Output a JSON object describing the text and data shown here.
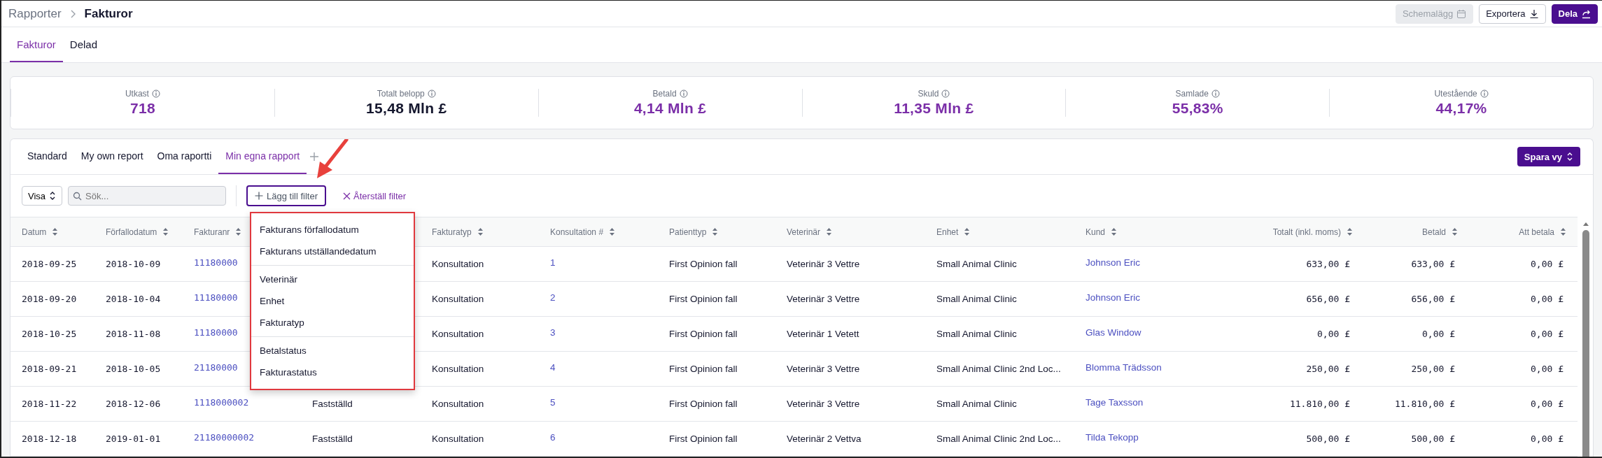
{
  "breadcrumb": [
    {
      "label": "Rapporter",
      "current": false
    },
    {
      "label": "Fakturor",
      "current": true
    }
  ],
  "actions": [
    {
      "label": "Schemalägg",
      "kind": "secondary",
      "disabled": true
    },
    {
      "label": "Exportera",
      "kind": "secondary",
      "disabled": false
    },
    {
      "label": "Dela",
      "kind": "primary",
      "disabled": false
    }
  ],
  "page_tabs": [
    {
      "label": "Fakturor",
      "selected": true
    },
    {
      "label": "Delad",
      "selected": false
    }
  ],
  "kpis": [
    {
      "label": "Utkast",
      "value": "718",
      "color": "#7b2fa8"
    },
    {
      "label": "Totalt belopp",
      "value": "15,48 Mln £",
      "color": "#15172e"
    },
    {
      "label": "Betald",
      "value": "4,14 Mln £",
      "color": "#7b2fa8"
    },
    {
      "label": "Skuld",
      "value": "11,35 Mln £",
      "color": "#7b2fa8"
    },
    {
      "label": "Samlade",
      "value": "55,83%",
      "color": "#7b2fa8"
    },
    {
      "label": "Utestående",
      "value": "44,17%",
      "color": "#7b2fa8"
    }
  ],
  "report_tabs": [
    {
      "label": "Standard",
      "selected": false
    },
    {
      "label": "My own report",
      "selected": false
    },
    {
      "label": "Oma raportti",
      "selected": false
    },
    {
      "label": "Min egna rapport",
      "selected": true
    }
  ],
  "save_view_button": "Spara vy",
  "filter_bar": {
    "show_select": "Visa",
    "search": {
      "placeholder": "Sök..."
    },
    "add_filter_button": "Lägg till filter",
    "reset_filter_link": "Återställ filter"
  },
  "filter_menu": {
    "groups": [
      {
        "items": [
          "Fakturans förfallodatum",
          "Fakturans utställandedatum"
        ]
      },
      {
        "items": [
          "Veterinär",
          "Enhet",
          "Fakturatyp"
        ]
      },
      {
        "items": [
          "Betalstatus",
          "Fakturastatus"
        ]
      }
    ]
  },
  "table": {
    "columns": [
      {
        "label": "Datum",
        "kind": "text"
      },
      {
        "label": "Förfallodatum",
        "kind": "text"
      },
      {
        "label": "Fakturanr",
        "kind": "text"
      },
      {
        "label": "Fakturatyp",
        "kind": "text"
      },
      {
        "label": "Konsultation #",
        "kind": "text"
      },
      {
        "label": "Patienttyp",
        "kind": "text"
      },
      {
        "label": "Veterinär",
        "kind": "text"
      },
      {
        "label": "Enhet",
        "kind": "text"
      },
      {
        "label": "Kund",
        "kind": "text"
      },
      {
        "label": "Totalt (inkl. moms)",
        "kind": "amount"
      },
      {
        "label": "Betald",
        "kind": "amount"
      },
      {
        "label": "Att betala",
        "kind": "amount"
      }
    ],
    "rows": [
      {
        "datum": "2018-09-25",
        "forfallodatum": "2018-10-09",
        "fakturanr": "11180000",
        "fakturatyp": "Konsultation",
        "konsultation": "1",
        "patienttyp": "First Opinion fall",
        "veterinar": "Veterinär 3 Vettre",
        "enhet": "Small Animal Clinic",
        "kund": "Johnson Eric",
        "totalt": "633,00 £",
        "betald": "633,00 £",
        "att_betala": "0,00 £"
      },
      {
        "datum": "2018-09-20",
        "forfallodatum": "2018-10-04",
        "fakturanr": "11180000",
        "fakturatyp": "Konsultation",
        "konsultation": "2",
        "patienttyp": "First Opinion fall",
        "veterinar": "Veterinär 3 Vettre",
        "enhet": "Small Animal Clinic",
        "kund": "Johnson Eric",
        "totalt": "656,00 £",
        "betald": "656,00 £",
        "att_betala": "0,00 £"
      },
      {
        "datum": "2018-10-25",
        "forfallodatum": "2018-11-08",
        "fakturanr": "11180000",
        "fakturatyp": "Konsultation",
        "konsultation": "3",
        "patienttyp": "First Opinion fall",
        "veterinar": "Veterinär 1 Vetett",
        "enhet": "Small Animal Clinic",
        "kund": "Glas Window",
        "totalt": "0,00 £",
        "betald": "0,00 £",
        "att_betala": "0,00 £"
      },
      {
        "datum": "2018-09-21",
        "forfallodatum": "2018-10-05",
        "fakturanr": "21180000",
        "fakturatyp": "Konsultation",
        "konsultation": "4",
        "patienttyp": "First Opinion fall",
        "veterinar": "Veterinär 3 Vettre",
        "enhet": "Small Animal Clinic 2nd Loc...",
        "kund": "Blomma Trädsson",
        "totalt": "250,00 £",
        "betald": "250,00 £",
        "att_betala": "0,00 £"
      },
      {
        "datum": "2018-11-22",
        "forfallodatum": "2018-12-06",
        "fakturanr": "1118000002",
        "column_4": "Fastställd",
        "fakturatyp": "Konsultation",
        "konsultation": "5",
        "patienttyp": "First Opinion fall",
        "veterinar": "Veterinär 3 Vettre",
        "enhet": "Small Animal Clinic",
        "kund": "Tage Taxsson",
        "totalt": "11.810,00 £",
        "betald": "11.810,00 £",
        "att_betala": "0,00 £"
      },
      {
        "datum": "2018-12-18",
        "forfallodatum": "2019-01-01",
        "fakturanr": "21180000002",
        "column_4": "Fastställd",
        "fakturatyp": "Konsultation",
        "konsultation": "6",
        "patienttyp": "First Opinion fall",
        "veterinar": "Veterinär 2 Vettva",
        "enhet": "Small Animal Clinic 2nd Loc...",
        "kund": "Tilda Tekopp",
        "totalt": "500,00 £",
        "betald": "500,00 £",
        "att_betala": "0,00 £"
      }
    ]
  }
}
